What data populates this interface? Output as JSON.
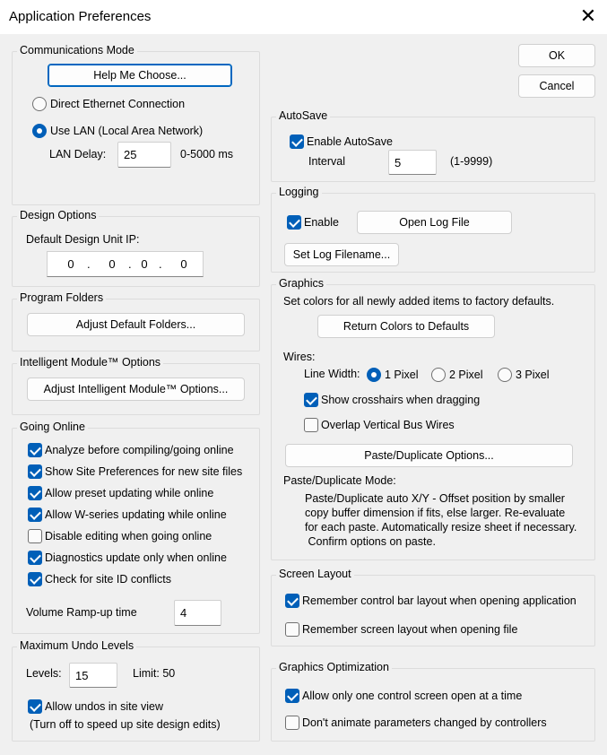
{
  "window": {
    "title": "Application Preferences"
  },
  "buttons": {
    "ok": "OK",
    "cancel": "Cancel"
  },
  "comm": {
    "label": "Communications Mode",
    "help_button": "Help Me Choose...",
    "direct": "Direct Ethernet Connection",
    "lan": "Use LAN (Local Area Network)",
    "lan_delay_label": "LAN Delay:",
    "lan_delay_value": "25",
    "lan_delay_range": "0-5000 ms"
  },
  "design": {
    "label": "Design Options",
    "ip_label": "Default Design Unit IP:",
    "ip": [
      "0",
      "0",
      "0",
      "0"
    ],
    "dot": "."
  },
  "folders": {
    "label": "Program Folders",
    "button": "Adjust Default Folders..."
  },
  "intelligent": {
    "label": "Intelligent Module™ Options",
    "button": "Adjust Intelligent Module™ Options..."
  },
  "online": {
    "label": "Going Online",
    "items": [
      {
        "label": "Analyze before compiling/going online",
        "checked": true
      },
      {
        "label": "Show Site Preferences for new site files",
        "checked": true
      },
      {
        "label": "Allow preset updating while online",
        "checked": true
      },
      {
        "label": "Allow W-series updating while online",
        "checked": true
      },
      {
        "label": "Disable editing when going online",
        "checked": false
      },
      {
        "label": "Diagnostics update only when online",
        "checked": true
      },
      {
        "label": "Check for site ID conflicts",
        "checked": true
      }
    ],
    "ramp_label": "Volume Ramp-up time",
    "ramp_value": "4"
  },
  "undo": {
    "label": "Maximum Undo Levels",
    "levels_label": "Levels:",
    "levels_value": "15",
    "limit": "Limit: 50",
    "allow": "Allow undos in site view",
    "note": "(Turn off to speed up site design edits)"
  },
  "autosave": {
    "label": "AutoSave",
    "enable": "Enable AutoSave",
    "interval_label": "Interval",
    "interval_value": "5",
    "interval_range": "(1-9999)"
  },
  "logging": {
    "label": "Logging",
    "enable": "Enable",
    "open_button": "Open Log File",
    "set_button": "Set Log Filename..."
  },
  "graphics": {
    "label": "Graphics",
    "desc": "Set colors for all newly added items to factory defaults.",
    "return_button": "Return Colors to Defaults",
    "wires": "Wires:",
    "line_width": "Line Width:",
    "w1": "1 Pixel",
    "w2": "2 Pixel",
    "w3": "3 Pixel",
    "crosshairs": "Show crosshairs when dragging",
    "overlap": "Overlap Vertical Bus Wires",
    "paste_button": "Paste/Duplicate Options...",
    "paste_mode_label": "Paste/Duplicate Mode:",
    "paste_desc": [
      "Paste/Duplicate auto X/Y - Offset position by smaller",
      "copy buffer dimension if fits, else larger.  Re-evaluate",
      "for each paste.  Automatically resize sheet if necessary.",
      " Confirm options on paste."
    ]
  },
  "screen": {
    "label": "Screen Layout",
    "control_bar": "Remember control bar layout when opening application",
    "screen_layout": "Remember screen layout when opening file"
  },
  "gopt": {
    "label": "Graphics Optimization",
    "one_screen": "Allow only one control screen open at a time",
    "no_animate": "Don't animate parameters changed by controllers"
  }
}
